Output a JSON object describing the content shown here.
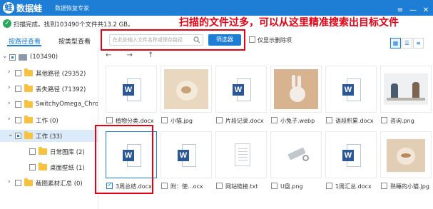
{
  "app": {
    "name": "数据蛙",
    "subtitle": "数据恢复专家",
    "window_controls": [
      "≡",
      "—",
      "✕"
    ]
  },
  "status": {
    "text": "扫描完成。找到103490个文件共13.2 GB。"
  },
  "annotation": "扫描的文件过多，可以从这里精准搜索出目标文件",
  "tabs": [
    {
      "label": "按路径查看",
      "active": true
    },
    {
      "label": "按类型查看",
      "active": false
    }
  ],
  "search": {
    "placeholder": "在此处输入文件名称或保存路径",
    "filter_label": "筛选器"
  },
  "show_deleted_label": "仅显示删除项",
  "view_buttons": [
    "▦",
    "☰",
    "≡"
  ],
  "nav_arrows": "← → ↑",
  "tree": [
    {
      "label": "(103490)",
      "chev": "⌄",
      "type": "drive",
      "level": 0,
      "check": "partial"
    },
    {
      "label": "其他路径 (29352)",
      "chev": "›",
      "type": "folder",
      "level": 1,
      "check": "none"
    },
    {
      "label": "丢失路径 (71392)",
      "chev": "›",
      "type": "folder",
      "level": 1,
      "check": "none"
    },
    {
      "label": "SwitchyOmega_Chromium",
      "chev": "›",
      "type": "folder",
      "level": 1,
      "check": "none"
    },
    {
      "label": "工作 (0)",
      "chev": "›",
      "type": "folder",
      "level": 1,
      "check": "none"
    },
    {
      "label": "工作 (33)",
      "chev": "⌄",
      "type": "folder",
      "level": 1,
      "check": "partial",
      "selected": true
    },
    {
      "label": "日常图库 (2)",
      "chev": "",
      "type": "folder",
      "level": 2,
      "check": "none"
    },
    {
      "label": "桌面壁纸 (1)",
      "chev": "",
      "type": "folder",
      "level": 2,
      "check": "none"
    },
    {
      "label": "截图素材汇总 (0)",
      "chev": "›",
      "type": "folder",
      "level": 1,
      "check": "none"
    }
  ],
  "files": [
    {
      "name": "植物分类.docx",
      "kind": "word",
      "checked": false
    },
    {
      "name": "小猫.jpg",
      "kind": "cat",
      "checked": false
    },
    {
      "name": "片段记录.docx",
      "kind": "word",
      "checked": false
    },
    {
      "name": "小兔子.webp",
      "kind": "rabbit",
      "checked": false
    },
    {
      "name": "语段积累.docx",
      "kind": "word",
      "checked": false
    },
    {
      "name": "咨询.png",
      "kind": "office",
      "checked": false
    },
    {
      "name": "3周总结.docx",
      "kind": "word",
      "checked": true,
      "selected": true
    },
    {
      "name": "附：使...ocx",
      "kind": "word",
      "checked": false
    },
    {
      "name": "网站链接.txt",
      "kind": "txt",
      "checked": false
    },
    {
      "name": "U盘.png",
      "kind": "usb",
      "checked": false
    },
    {
      "name": "1周汇总.docx",
      "kind": "word",
      "checked": false
    },
    {
      "name": "熟睡的小猫.jpg",
      "kind": "kitty",
      "checked": false
    }
  ]
}
